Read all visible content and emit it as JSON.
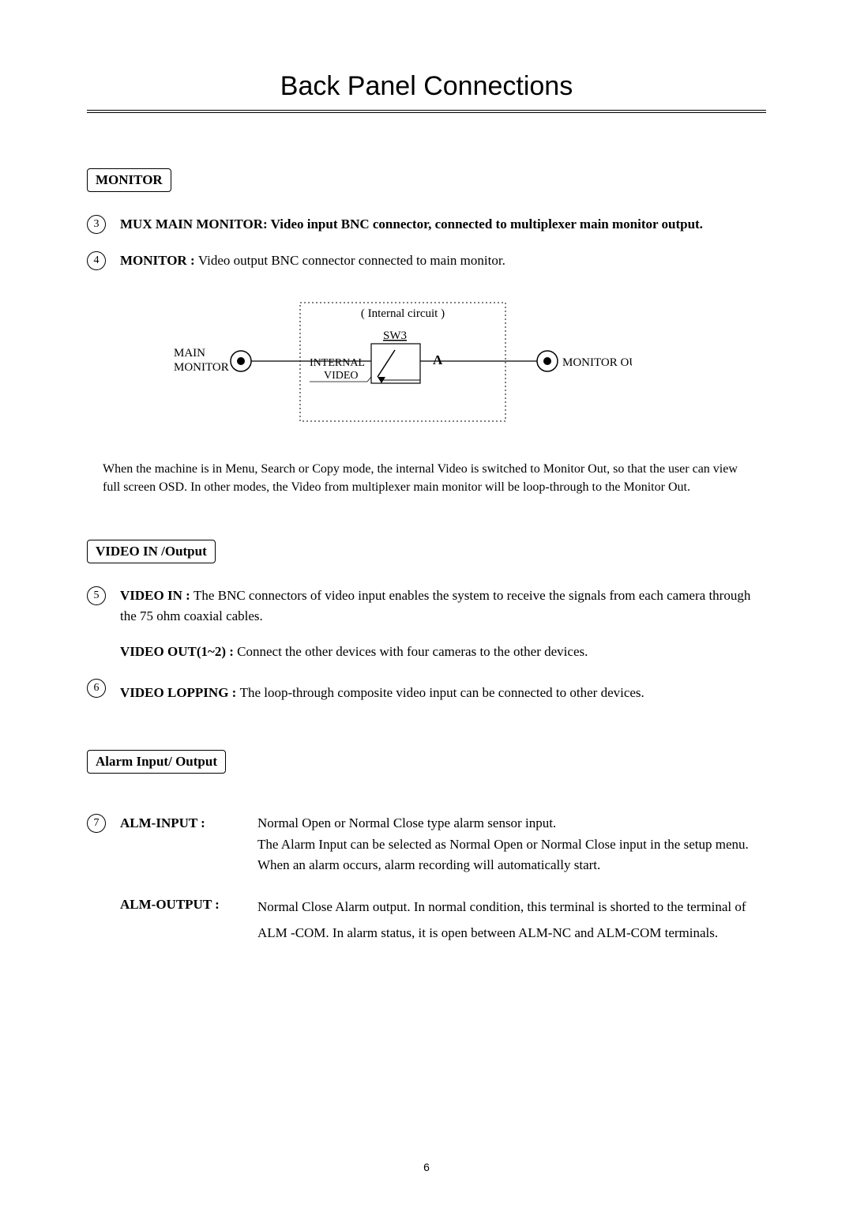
{
  "title": "Back Panel Connections",
  "sections": {
    "monitor": {
      "label": "MONITOR",
      "items": [
        {
          "num": "3",
          "label": "MUX MAIN MONITOR: ",
          "text": "Video input BNC connector, connected to multiplexer main monitor output.",
          "bold_all": true
        },
        {
          "num": "4",
          "label": "MONITOR : ",
          "text": "Video output BNC connector connected to main monitor."
        }
      ],
      "diagram": {
        "internal_circuit": "( Internal circuit )",
        "sw3": "SW3",
        "main_monitor": "MAIN\nMONITOR",
        "internal_video": "INTERNAL\nVIDEO",
        "a": "A",
        "monitor_out": "MONITOR OUT"
      },
      "explain": "When the machine is in Menu, Search or Copy mode, the internal Video is switched to Monitor Out, so that the user can view full screen OSD.  In other modes, the Video from multiplexer main monitor will be loop-through to the Monitor Out."
    },
    "video": {
      "label": "VIDEO  IN /Output",
      "item5": {
        "num": "5",
        "label1": "VIDEO IN : ",
        "text1": "The BNC connectors of video input enables the system to receive the signals from each camera through the 75 ohm coaxial cables.",
        "label2": "VIDEO OUT(1~2) : ",
        "text2": "Connect the other devices with four cameras to the other devices."
      },
      "item6": {
        "num": "6",
        "label": "VIDEO LOPPING : ",
        "text": "The loop-through composite video input can be connected to other devices."
      }
    },
    "alarm": {
      "label": "Alarm Input/ Output",
      "num": "7",
      "alm_input_label": "ALM-INPUT :",
      "alm_input_text": "Normal Open or Normal Close type alarm sensor input.\nThe Alarm Input can be selected as Normal Open or Normal Close input in the setup menu. When an alarm occurs, alarm recording will automatically start.",
      "alm_output_label": "ALM-OUTPUT :",
      "alm_output_text": "Normal Close Alarm output. In normal condition, this terminal is shorted to the terminal of ALM -COM. In alarm status, it is open between ALM-NC and ALM-COM terminals."
    }
  },
  "page_number": "6"
}
